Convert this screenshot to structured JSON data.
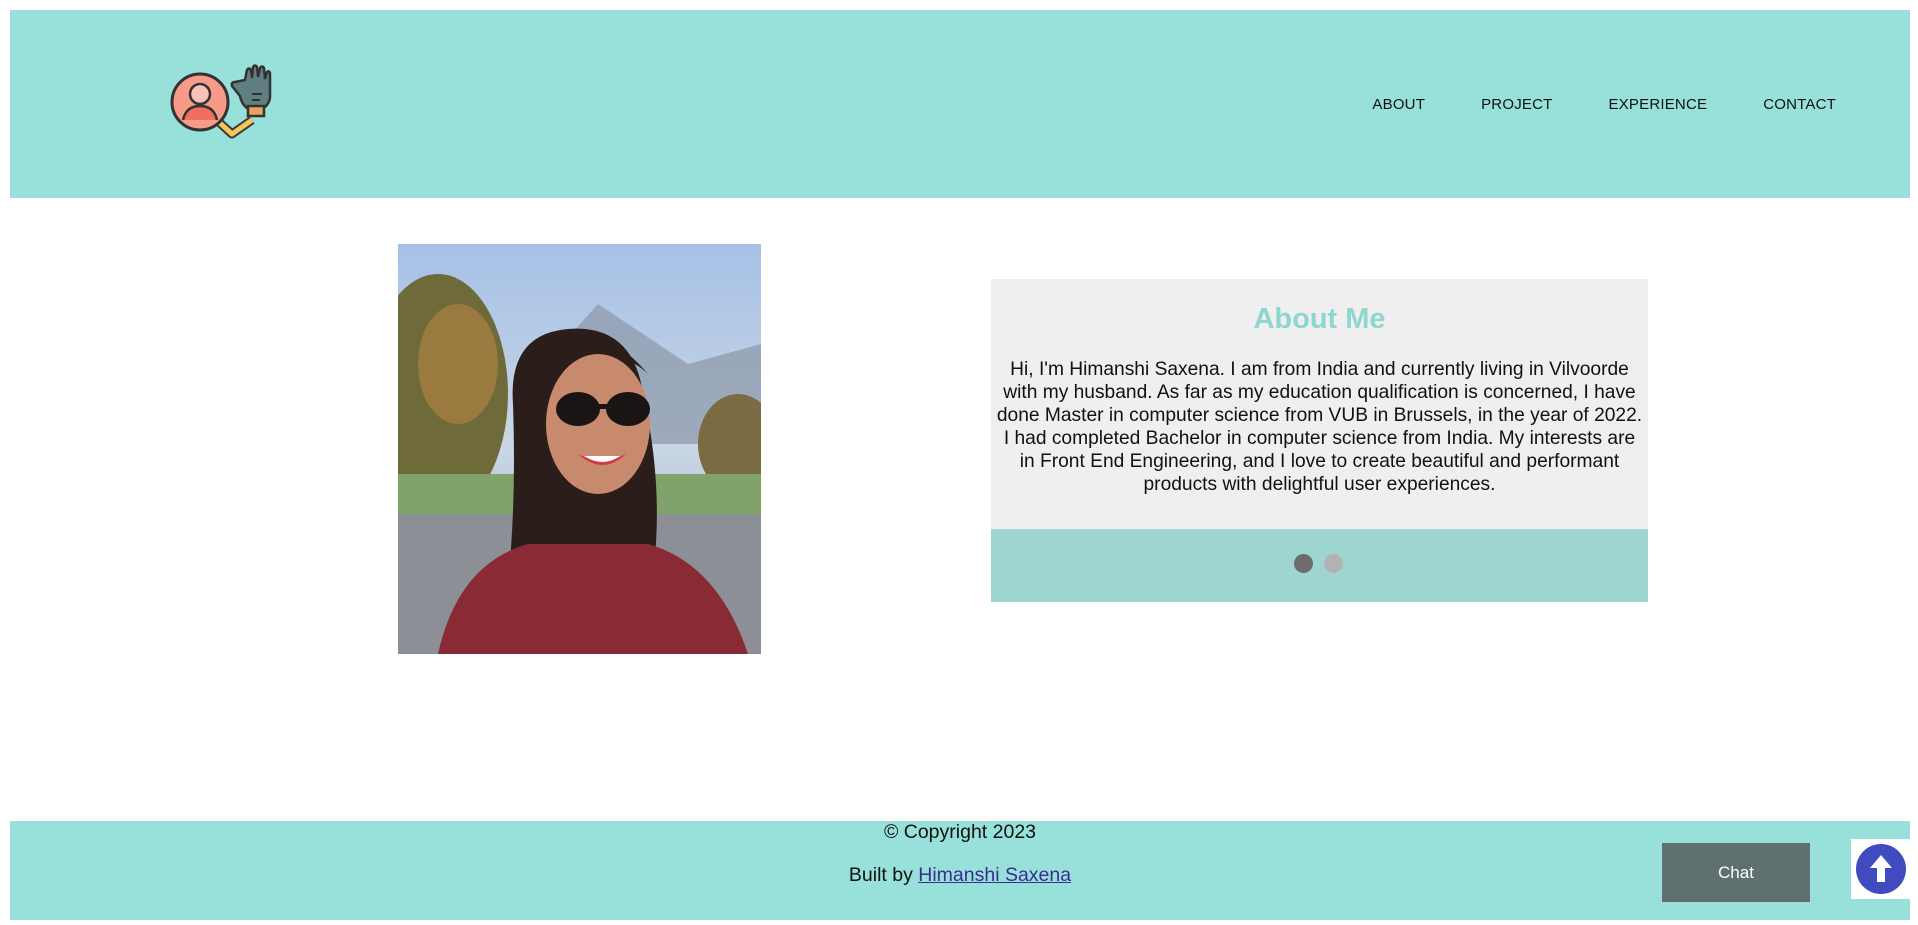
{
  "header": {
    "logo_icon": "user-hand-logo-icon",
    "nav": [
      "ABOUT",
      "PROJECT",
      "EXPERIENCE",
      "CONTACT"
    ]
  },
  "main": {
    "photo_icon": "profile-photo",
    "about": {
      "title": "About Me",
      "text": "Hi, I'm Himanshi Saxena. I am from India and currently living in Vilvoorde with my husband. As far as my education qualification is concerned, I have done Master in computer science from VUB in Brussels, in the year of 2022. I had completed Bachelor in computer science from India. My interests are in Front End Engineering, and I love to create beautiful and performant products with delightful user experiences."
    },
    "carousel": {
      "slides": 2,
      "active": 1
    }
  },
  "footer": {
    "copyright": "© Copyright 2023",
    "built_by": "Built by",
    "author_link": "Himanshi Saxena"
  },
  "chat": {
    "label": "Chat"
  },
  "scroll_top": {
    "icon": "arrow-up-icon"
  },
  "colors": {
    "accent_teal": "#98e0da",
    "card_bg": "#efefef",
    "title_teal": "#8fd6cf",
    "chat_button": "#607070",
    "scroll_button": "#3f4bbf"
  }
}
